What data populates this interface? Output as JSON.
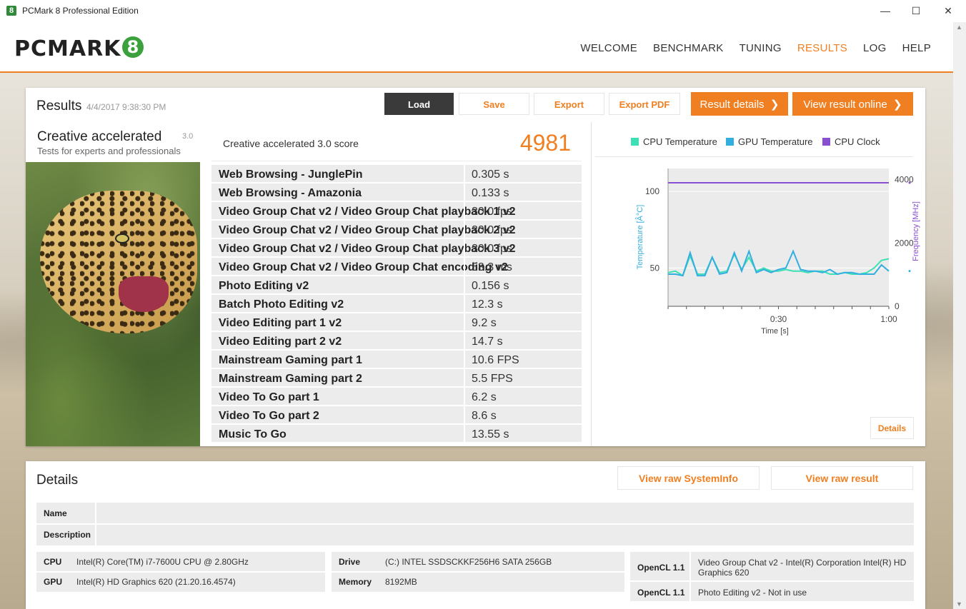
{
  "window": {
    "title": "PCMark 8 Professional Edition",
    "icon_text": "8"
  },
  "header": {
    "logo_text": "PCMARK",
    "logo_digit": "8",
    "nav": [
      {
        "label": "WELCOME",
        "active": false
      },
      {
        "label": "BENCHMARK",
        "active": false
      },
      {
        "label": "TUNING",
        "active": false
      },
      {
        "label": "RESULTS",
        "active": true
      },
      {
        "label": "LOG",
        "active": false
      },
      {
        "label": "HELP",
        "active": false
      }
    ]
  },
  "results": {
    "title": "Results",
    "date": "4/4/2017 9:38:30 PM",
    "buttons": {
      "load": "Load",
      "save": "Save",
      "export": "Export",
      "export_pdf": "Export PDF",
      "result_details": "Result details",
      "view_online": "View result online"
    },
    "benchmark": {
      "name": "Creative accelerated",
      "version": "3.0",
      "description": "Tests for experts and professionals"
    },
    "score": {
      "label": "Creative accelerated 3.0 score",
      "value": "4981"
    },
    "subtests": [
      {
        "name": "Web Browsing - JunglePin",
        "value": "0.305 s"
      },
      {
        "name": "Web Browsing - Amazonia",
        "value": "0.133 s"
      },
      {
        "name": "Video Group Chat v2 / Video Group Chat playback 1 v2",
        "value": "30.0 fps"
      },
      {
        "name": "Video Group Chat v2 / Video Group Chat playback 2 v2",
        "value": "30.0 fps"
      },
      {
        "name": "Video Group Chat v2 / Video Group Chat playback 3 v2",
        "value": "30.0 fps"
      },
      {
        "name": "Video Group Chat v2 / Video Group Chat encoding v2",
        "value": "53.3 ms"
      },
      {
        "name": "Photo Editing v2",
        "value": "0.156 s"
      },
      {
        "name": "Batch Photo Editing v2",
        "value": "12.3 s"
      },
      {
        "name": "Video Editing part 1 v2",
        "value": "9.2 s"
      },
      {
        "name": "Video Editing part 2 v2",
        "value": "14.7 s"
      },
      {
        "name": "Mainstream Gaming part 1",
        "value": "10.6 FPS"
      },
      {
        "name": "Mainstream Gaming part 2",
        "value": "5.5 FPS"
      },
      {
        "name": "Video To Go part 1",
        "value": "6.2 s"
      },
      {
        "name": "Video To Go part 2",
        "value": "8.6 s"
      },
      {
        "name": "Music To Go",
        "value": "13.55 s"
      }
    ],
    "details_button": "Details"
  },
  "chart_data": {
    "type": "line",
    "xlabel": "Time [s]",
    "ylabel_left": "Temperature [Â°C]",
    "ylabel_right": "Frequency [MHz]",
    "x_ticks": [
      "0:30",
      "1:00"
    ],
    "y_left_ticks": [
      "100",
      "50"
    ],
    "y_right_ticks": [
      "4000",
      "2000",
      "0"
    ],
    "x_range": [
      0,
      60
    ],
    "y_left_range": [
      25,
      115
    ],
    "y_right_range": [
      0,
      4350
    ],
    "grid": true,
    "legend_position": "top",
    "series": [
      {
        "name": "CPU Temperature",
        "color": "#3de0b4",
        "axis": "left",
        "x": [
          0,
          2,
          4,
          6,
          8,
          10,
          12,
          14,
          16,
          18,
          20,
          22,
          24,
          26,
          28,
          30,
          32,
          34,
          36,
          38,
          40,
          42,
          44,
          46,
          48,
          50,
          52,
          54,
          56,
          58,
          60
        ],
        "y": [
          47,
          48,
          45,
          58,
          46,
          46,
          57,
          47,
          48,
          59,
          49,
          57,
          48,
          50,
          48,
          48,
          49,
          48,
          48,
          47,
          48,
          48,
          46,
          46,
          47,
          46,
          46,
          47,
          50,
          55,
          56
        ]
      },
      {
        "name": "GPU Temperature",
        "color": "#33aee0",
        "axis": "left",
        "x": [
          0,
          2,
          4,
          6,
          8,
          10,
          12,
          14,
          16,
          18,
          20,
          22,
          24,
          26,
          28,
          30,
          32,
          34,
          36,
          38,
          40,
          42,
          44,
          46,
          48,
          50,
          52,
          54,
          56,
          58,
          60
        ],
        "y": [
          46,
          46,
          45,
          60,
          45,
          45,
          57,
          46,
          47,
          60,
          48,
          61,
          47,
          49,
          47,
          49,
          50,
          61,
          49,
          48,
          48,
          47,
          49,
          46,
          47,
          47,
          46,
          46,
          46,
          52,
          48
        ]
      },
      {
        "name": "CPU Clock",
        "color": "#8a4fd0",
        "axis": "right",
        "x": [
          0,
          60
        ],
        "y": [
          3900,
          3900
        ]
      }
    ]
  },
  "details": {
    "title": "Details",
    "view_sysinfo": "View raw SystemInfo",
    "view_raw": "View raw result",
    "name_label": "Name",
    "description_label": "Description",
    "cpu_label": "CPU",
    "cpu_value": "Intel(R) Core(TM) i7-7600U CPU @ 2.80GHz",
    "gpu_label": "GPU",
    "gpu_value": "Intel(R) HD Graphics 620 (21.20.16.4574)",
    "drive_label": "Drive",
    "drive_value": "(C:) INTEL SSDSCKKF256H6 SATA 256GB",
    "memory_label": "Memory",
    "memory_value": "8192MB",
    "opencl": [
      {
        "label": "OpenCL 1.1",
        "value": "Video Group Chat v2 - Intel(R) Corporation Intel(R) HD Graphics 620"
      },
      {
        "label": "OpenCL 1.1",
        "value": "Photo Editing v2 - Not in use"
      }
    ]
  }
}
